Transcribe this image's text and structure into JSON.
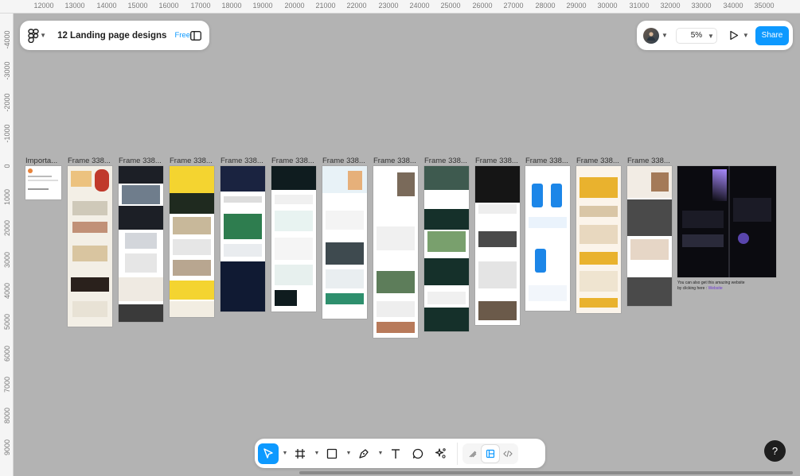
{
  "ruler": {
    "top": [
      "12000",
      "13000",
      "14000",
      "15000",
      "16000",
      "17000",
      "18000",
      "19000",
      "20000",
      "21000",
      "22000",
      "23000",
      "24000",
      "25000",
      "26000",
      "27000",
      "28000",
      "29000",
      "30000",
      "31000",
      "32000",
      "33000",
      "34000",
      "35000"
    ],
    "left": [
      "-4000",
      "-3000",
      "-2000",
      "-1000",
      "0",
      "1000",
      "2000",
      "3000",
      "4000",
      "5000",
      "6000",
      "7000",
      "8000",
      "9000"
    ]
  },
  "file": {
    "title": "12 Landing page designs",
    "plan_badge": "Free"
  },
  "header": {
    "zoom": "5%",
    "share_label": "Share"
  },
  "frames": [
    {
      "label": "Importa..."
    },
    {
      "label": "Frame 338..."
    },
    {
      "label": "Frame 338..."
    },
    {
      "label": "Frame 338..."
    },
    {
      "label": "Frame 338..."
    },
    {
      "label": "Frame 338..."
    },
    {
      "label": "Frame 338..."
    },
    {
      "label": "Frame 338..."
    },
    {
      "label": "Frame 338..."
    },
    {
      "label": "Frame 338..."
    },
    {
      "label": "Frame 338..."
    },
    {
      "label": "Frame 338..."
    },
    {
      "label": "Frame 338..."
    }
  ],
  "canvas_note": {
    "text": "You can also get this amazing website by clicking here : ",
    "link": "Website"
  },
  "toolbar": {
    "tools": [
      "move-icon",
      "frame-icon",
      "rectangle-icon",
      "pen-icon",
      "text-icon",
      "comment-icon",
      "actions-icon"
    ],
    "modes": [
      "draw-mode-icon",
      "design-mode-icon",
      "dev-mode-icon"
    ]
  },
  "help": {
    "label": "?"
  },
  "colors": {
    "accent": "#0d99ff",
    "canvas": "#b3b3b3"
  }
}
